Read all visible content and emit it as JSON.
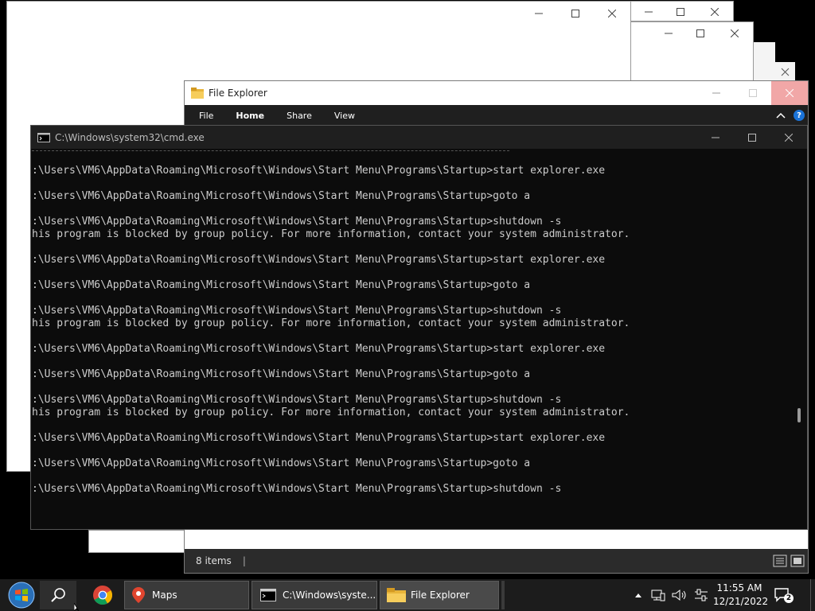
{
  "explorer": {
    "title": "File Explorer",
    "tabs": [
      "File",
      "Home",
      "Share",
      "View"
    ],
    "status": "8 items",
    "help_label": "?"
  },
  "cmd": {
    "title": "C:\\Windows\\system32\\cmd.exe",
    "lines": [
      ":\\Users\\VM6\\AppData\\Roaming\\Microsoft\\Windows\\Start Menu\\Programs\\Startup>start explorer.exe",
      "",
      ":\\Users\\VM6\\AppData\\Roaming\\Microsoft\\Windows\\Start Menu\\Programs\\Startup>goto a",
      "",
      ":\\Users\\VM6\\AppData\\Roaming\\Microsoft\\Windows\\Start Menu\\Programs\\Startup>shutdown -s",
      "his program is blocked by group policy. For more information, contact your system administrator.",
      "",
      ":\\Users\\VM6\\AppData\\Roaming\\Microsoft\\Windows\\Start Menu\\Programs\\Startup>start explorer.exe",
      "",
      ":\\Users\\VM6\\AppData\\Roaming\\Microsoft\\Windows\\Start Menu\\Programs\\Startup>goto a",
      "",
      ":\\Users\\VM6\\AppData\\Roaming\\Microsoft\\Windows\\Start Menu\\Programs\\Startup>shutdown -s",
      "his program is blocked by group policy. For more information, contact your system administrator.",
      "",
      ":\\Users\\VM6\\AppData\\Roaming\\Microsoft\\Windows\\Start Menu\\Programs\\Startup>start explorer.exe",
      "",
      ":\\Users\\VM6\\AppData\\Roaming\\Microsoft\\Windows\\Start Menu\\Programs\\Startup>goto a",
      "",
      ":\\Users\\VM6\\AppData\\Roaming\\Microsoft\\Windows\\Start Menu\\Programs\\Startup>shutdown -s",
      "his program is blocked by group policy. For more information, contact your system administrator.",
      "",
      ":\\Users\\VM6\\AppData\\Roaming\\Microsoft\\Windows\\Start Menu\\Programs\\Startup>start explorer.exe",
      "",
      ":\\Users\\VM6\\AppData\\Roaming\\Microsoft\\Windows\\Start Menu\\Programs\\Startup>goto a",
      "",
      ":\\Users\\VM6\\AppData\\Roaming\\Microsoft\\Windows\\Start Menu\\Programs\\Startup>shutdown -s"
    ]
  },
  "taskbar": {
    "items": [
      {
        "label": "Maps",
        "icon": "maps-icon"
      },
      {
        "label": "C:\\Windows\\syste...",
        "icon": "cmd-icon"
      },
      {
        "label": "File Explorer",
        "icon": "folder-icon"
      }
    ],
    "time": "11:55 AM",
    "date": "12/21/2022",
    "notification_count": "2"
  },
  "colors": {
    "taskbar_bg": "#1c1c1c",
    "console_bg": "#0c0c0c",
    "console_fg": "#cccccc",
    "close_hover": "#e81123"
  }
}
